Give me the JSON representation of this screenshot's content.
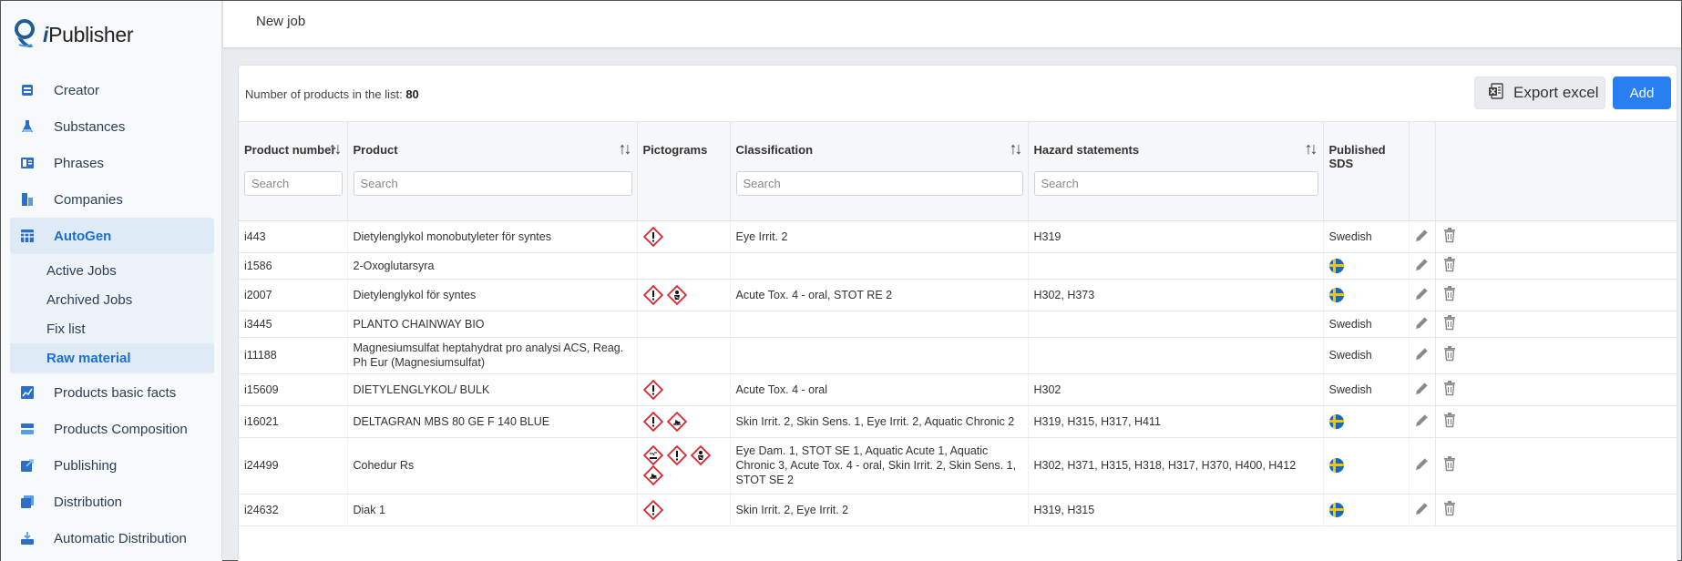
{
  "app": {
    "name_prefix": "i",
    "name": "Publisher"
  },
  "sidebar": {
    "items": [
      {
        "label": "Creator",
        "icon": "document-stack-icon"
      },
      {
        "label": "Substances",
        "icon": "flask-icon"
      },
      {
        "label": "Phrases",
        "icon": "book-icon"
      },
      {
        "label": "Companies",
        "icon": "building-icon"
      },
      {
        "label": "AutoGen",
        "icon": "grid-icon",
        "active": true
      },
      {
        "label": "Products basic facts",
        "icon": "chart-icon"
      },
      {
        "label": "Products Composition",
        "icon": "layers-icon"
      },
      {
        "label": "Publishing",
        "icon": "export-icon"
      },
      {
        "label": "Distribution",
        "icon": "copy-icon"
      },
      {
        "label": "Automatic Distribution",
        "icon": "tray-icon"
      }
    ],
    "autogen_sub": [
      {
        "label": "Active Jobs"
      },
      {
        "label": "Archived Jobs"
      },
      {
        "label": "Fix list"
      },
      {
        "label": "Raw material",
        "active": true
      }
    ]
  },
  "topbar": {
    "tab": "New job"
  },
  "list": {
    "count_label": "Number of products in the list:",
    "count": "80",
    "export_label": "Export excel",
    "add_label": "Add"
  },
  "columns": {
    "product_number": "Product number",
    "product": "Product",
    "pictograms": "Pictograms",
    "classification": "Classification",
    "hazard": "Hazard statements",
    "published": "Published SDS",
    "search_placeholder": "Search"
  },
  "rows": [
    {
      "num": "i443",
      "product": "Dietylenglykol monobutyleter för syntes",
      "pictos": [
        "exclamation"
      ],
      "classification": "Eye Irrit. 2",
      "hazard": "H319",
      "sds": "Swedish"
    },
    {
      "num": "i1586",
      "product": "2-Oxoglutarsyra",
      "pictos": [],
      "classification": "",
      "hazard": "",
      "sds": "flag"
    },
    {
      "num": "i2007",
      "product": "Dietylenglykol för syntes",
      "pictos": [
        "exclamation",
        "health"
      ],
      "classification": "Acute Tox. 4 - oral, STOT RE 2",
      "hazard": "H302, H373",
      "sds": "flag"
    },
    {
      "num": "i3445",
      "product": "PLANTO CHAINWAY BIO",
      "pictos": [],
      "classification": "",
      "hazard": "",
      "sds": "Swedish"
    },
    {
      "num": "i11188",
      "product": "Magnesiumsulfat heptahydrat pro analysi ACS, Reag. Ph Eur (Magnesiumsulfat)",
      "pictos": [],
      "classification": "",
      "hazard": "",
      "sds": "Swedish"
    },
    {
      "num": "i15609",
      "product": "DIETYLENGLYKOL/ BULK",
      "pictos": [
        "exclamation"
      ],
      "classification": "Acute Tox. 4 - oral",
      "hazard": "H302",
      "sds": "Swedish"
    },
    {
      "num": "i16021",
      "product": "DELTAGRAN MBS 80 GE F 140 BLUE",
      "pictos": [
        "exclamation",
        "environment"
      ],
      "classification": "Skin Irrit. 2, Skin Sens. 1, Eye Irrit. 2, Aquatic Chronic 2",
      "hazard": "H319, H315, H317, H411",
      "sds": "flag"
    },
    {
      "num": "i24499",
      "product": "Cohedur Rs",
      "pictos": [
        "corrosion",
        "exclamation",
        "health",
        "environment"
      ],
      "classification": "Eye Dam. 1, STOT SE 1, Aquatic Acute 1, Aquatic Chronic 3, Acute Tox. 4 - oral, Skin Irrit. 2, Skin Sens. 1, STOT SE 2",
      "hazard": "H302, H371, H315, H318, H317, H370, H400, H412",
      "sds": "flag"
    },
    {
      "num": "i24632",
      "product": "Diak 1",
      "pictos": [
        "exclamation"
      ],
      "classification": "Skin Irrit. 2, Eye Irrit. 2",
      "hazard": "H319, H315",
      "sds": "flag"
    }
  ]
}
